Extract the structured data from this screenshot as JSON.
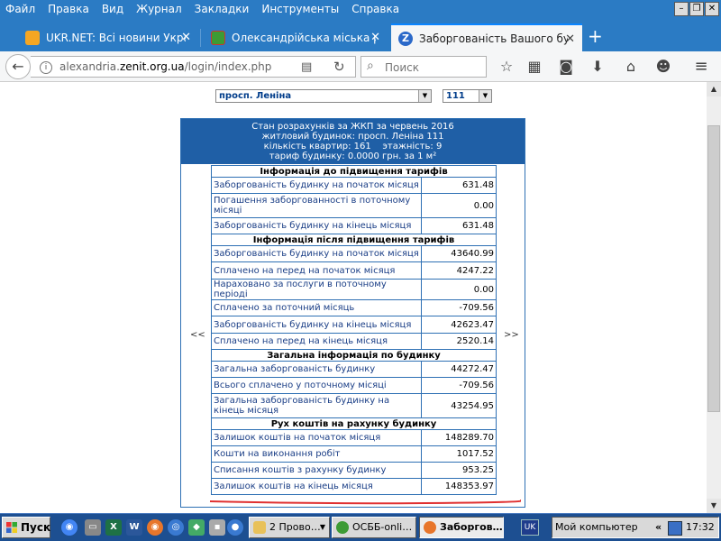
{
  "menubar": {
    "items": [
      "Файл",
      "Правка",
      "Вид",
      "Журнал",
      "Закладки",
      "Инструменты",
      "Справка"
    ]
  },
  "tabs": [
    {
      "title": "UKR.NET: Всі новини Україн…",
      "color": "#f5a623",
      "active": false
    },
    {
      "title": "Олександрійська міська рад…",
      "color": "#3d9b35",
      "active": false
    },
    {
      "title": "Заборгованість Вашого буд…",
      "color": "#2b69c9",
      "active": true,
      "favicon_letter": "Z"
    }
  ],
  "navbar": {
    "url_prefix": "alexandria.",
    "url_domain": "zenit.org.ua",
    "url_path": "/login/index.php",
    "search_placeholder": "Поиск"
  },
  "selectors": {
    "street": "просп. Леніна",
    "house": "111"
  },
  "panel": {
    "header_lines": [
      "Стан розрахунків за ЖКП за червень 2016",
      "житловий будинок: просп. Леніна 111",
      "кількість квартир: 161    этажність: 9",
      "тариф будинку: 0.0000 грн. за 1 м²"
    ],
    "prev_label": "<<",
    "next_label": ">>",
    "sections": [
      {
        "title": "Інформація до підвищення тарифів",
        "rows": [
          {
            "label": "Заборгованість будинку на початок місяця",
            "value": "631.48"
          },
          {
            "label": "Погашення заборгованності в поточному місяці",
            "value": "0.00"
          },
          {
            "label": "Заборгованість будинку на кінець місяця",
            "value": "631.48"
          }
        ]
      },
      {
        "title": "Інформація після підвищення тарифів",
        "rows": [
          {
            "label": "Заборгованість будинку на початок місяця",
            "value": "43640.99"
          },
          {
            "label": "Сплачено на перед на початок місяця",
            "value": "4247.22"
          },
          {
            "label": "Нараховано за послуги в поточному періоді",
            "value": "0.00"
          },
          {
            "label": "Сплачено за поточний місяць",
            "value": "-709.56"
          },
          {
            "label": "Заборгованість будинку на кінець місяця",
            "value": "42623.47"
          },
          {
            "label": "Сплачено на перед на кінець місяця",
            "value": "2520.14"
          }
        ]
      },
      {
        "title": "Загальна інформація по будинку",
        "rows": [
          {
            "label": "Загальна заборгованість будинку",
            "value": "44272.47"
          },
          {
            "label": "Всього сплачено у поточному місяці",
            "value": "-709.56"
          },
          {
            "label": "Загальна заборгованість будинку на кінець місяця",
            "value": "43254.95"
          }
        ]
      },
      {
        "title": "Рух коштів на рахунку будинку",
        "rows": [
          {
            "label": "Залишок коштів на початок місяця",
            "value": "148289.70"
          },
          {
            "label": "Кошти на виконання робіт",
            "value": "1017.52"
          },
          {
            "label": "Списання коштів з рахунку будинку",
            "value": "953.25"
          },
          {
            "label": "Залишок коштів на кінець місяця",
            "value": "148353.97"
          }
        ]
      }
    ]
  },
  "taskbar": {
    "start_label": "Пуск",
    "tasks": [
      {
        "label": "2 Прово…",
        "color": "#e8c15a",
        "active": false
      },
      {
        "label": "ОСББ-onli…",
        "color": "#3d9b35",
        "active": false
      },
      {
        "label": "Заборгов…",
        "color": "#e8762b",
        "active": true
      }
    ],
    "language": "UK",
    "tray_label": "Мой компьютер",
    "tray_chevron": "«",
    "clock": "17:32"
  },
  "colors": {
    "chrome_blue": "#2b7bc4",
    "panel_blue": "#1f5fa6",
    "annotation_red": "#e03030"
  }
}
